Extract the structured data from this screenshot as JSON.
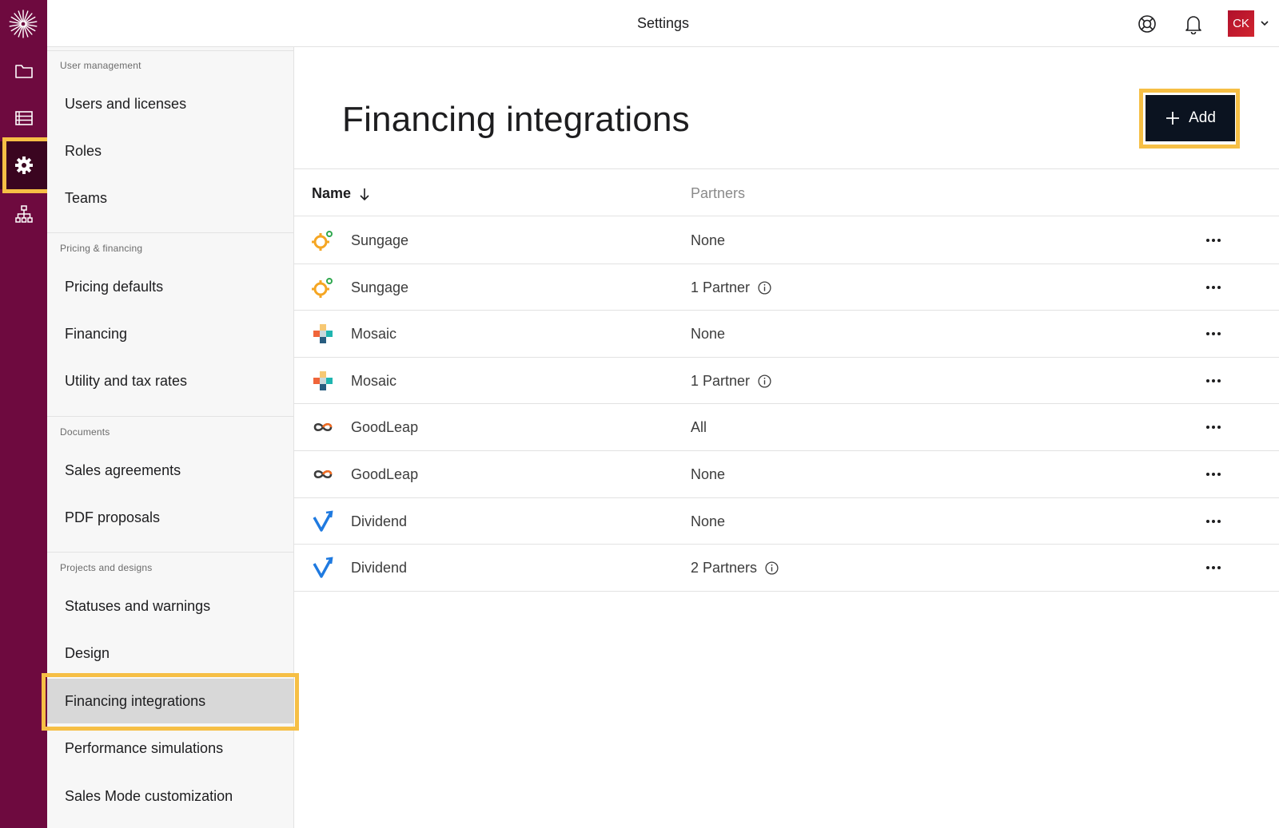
{
  "header": {
    "title": "Settings",
    "avatar_initials": "CK"
  },
  "rail": {
    "items": [
      {
        "name": "folder-icon"
      },
      {
        "name": "list-icon"
      },
      {
        "name": "gear-icon",
        "active": true
      },
      {
        "name": "org-chart-icon"
      }
    ]
  },
  "sidebar": {
    "sections": [
      {
        "label": "User management",
        "items": [
          "Users and licenses",
          "Roles",
          "Teams"
        ]
      },
      {
        "label": "Pricing & financing",
        "items": [
          "Pricing defaults",
          "Financing",
          "Utility and tax rates"
        ]
      },
      {
        "label": "Documents",
        "items": [
          "Sales agreements",
          "PDF proposals"
        ]
      },
      {
        "label": "Projects and designs",
        "items": [
          "Statuses and warnings",
          "Design",
          "Financing integrations",
          "Performance simulations",
          "Sales Mode customization"
        ]
      }
    ],
    "selected": "Financing integrations"
  },
  "main": {
    "title": "Financing integrations",
    "add_label": "Add",
    "columns": {
      "name": "Name",
      "partners": "Partners"
    },
    "rows": [
      {
        "logo": "sungage-logo-icon",
        "name": "Sungage",
        "partners": "None",
        "info": false
      },
      {
        "logo": "sungage-logo-icon",
        "name": "Sungage",
        "partners": "1 Partner",
        "info": true
      },
      {
        "logo": "mosaic-logo-icon",
        "name": "Mosaic",
        "partners": "None",
        "info": false
      },
      {
        "logo": "mosaic-logo-icon",
        "name": "Mosaic",
        "partners": "1 Partner",
        "info": true
      },
      {
        "logo": "goodleap-logo-icon",
        "name": "GoodLeap",
        "partners": "All",
        "info": false
      },
      {
        "logo": "goodleap-logo-icon",
        "name": "GoodLeap",
        "partners": "None",
        "info": false
      },
      {
        "logo": "dividend-logo-icon",
        "name": "Dividend",
        "partners": "None",
        "info": false
      },
      {
        "logo": "dividend-logo-icon",
        "name": "Dividend",
        "partners": "2 Partners",
        "info": true
      }
    ]
  },
  "colors": {
    "rail": "#6e0a3f",
    "rail_active": "#3a0520",
    "highlight": "#f6bf45",
    "add_button": "#0b1320",
    "avatar": "#c01a2e"
  }
}
